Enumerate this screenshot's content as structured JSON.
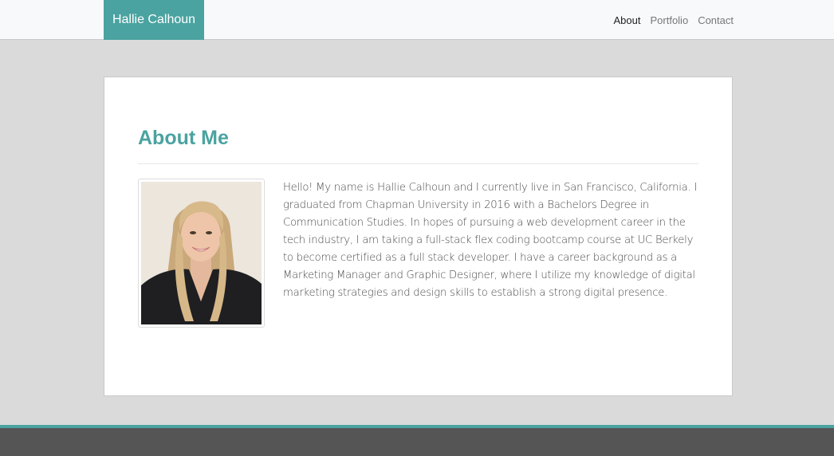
{
  "navbar": {
    "brand": "Hallie Calhoun",
    "links": [
      {
        "label": "About",
        "active": true
      },
      {
        "label": "Portfolio",
        "active": false
      },
      {
        "label": "Contact",
        "active": false
      }
    ]
  },
  "about": {
    "title": "About Me",
    "photo_icon": "profile-photo",
    "bio": "Hello! My name is Hallie Calhoun and I currently live in San Francisco, California. I graduated from Chapman University in 2016 with a Bachelors Degree in Communication Studies. In hopes of pursuing a web development career in the tech industry, I am taking a full-stack flex coding bootcamp course at UC Berkely to become certified as a full stack developer. I have a career background as a Marketing Manager and Graphic Designer, where I utilize my knowledge of digital marketing strategies and design skills to establish a strong digital presence."
  },
  "colors": {
    "accent": "#4aa3a0",
    "page_background": "#dadada",
    "footer": "#555555"
  }
}
